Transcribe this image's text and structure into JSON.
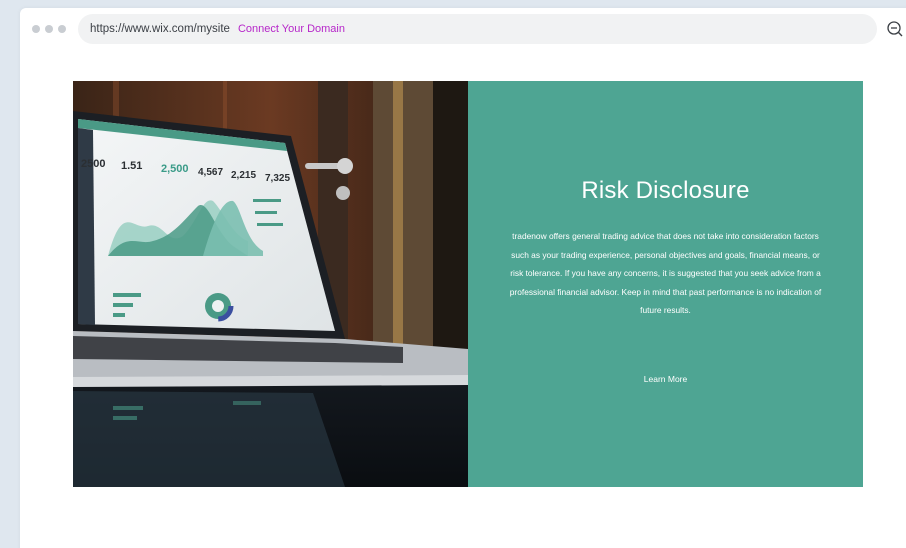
{
  "browser": {
    "url": "https://www.wix.com/mysite",
    "connect_domain": "Connect Your Domain"
  },
  "laptop_screen": {
    "stats": [
      "2500",
      "1.51",
      "2,500",
      "4,567",
      "2,215",
      "7,325"
    ]
  },
  "section": {
    "title": "Risk Disclosure",
    "body": "tradenow offers general trading advice that does not take into consideration factors such as your trading experience, personal objectives and goals, financial means, or risk tolerance. If you have any concerns, it is suggested that you seek advice from a professional financial advisor. Keep in mind that past performance is no indication of future results.",
    "cta": "Learn More",
    "background_color": "#4ea593"
  },
  "icons": {
    "zoom": "zoom-out-icon"
  }
}
